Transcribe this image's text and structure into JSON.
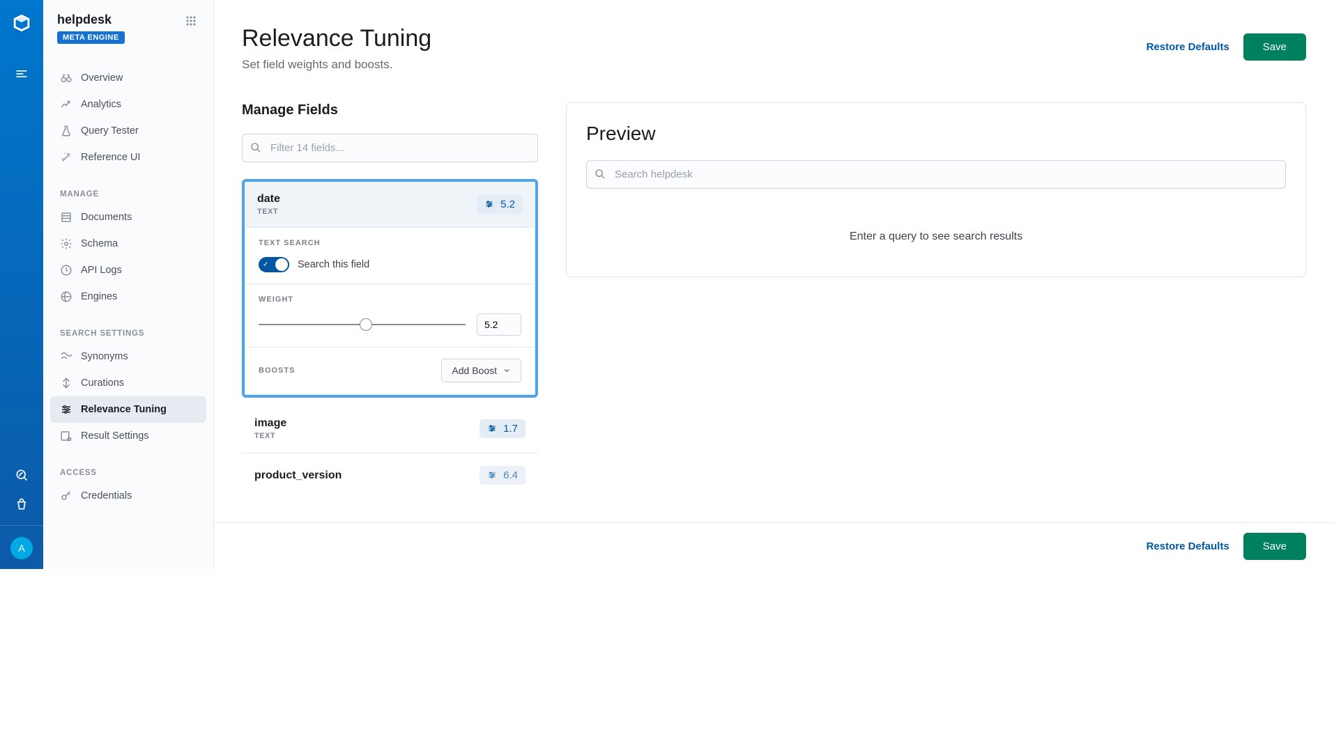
{
  "rail": {
    "avatar_letter": "A"
  },
  "sidebar": {
    "title": "helpdesk",
    "badge": "META ENGINE",
    "items": [
      {
        "label": "Overview"
      },
      {
        "label": "Analytics"
      },
      {
        "label": "Query Tester"
      },
      {
        "label": "Reference UI"
      }
    ],
    "manage_label": "MANAGE",
    "manage_items": [
      {
        "label": "Documents"
      },
      {
        "label": "Schema"
      },
      {
        "label": "API Logs"
      },
      {
        "label": "Engines"
      }
    ],
    "search_settings_label": "SEARCH SETTINGS",
    "search_items": [
      {
        "label": "Synonyms"
      },
      {
        "label": "Curations"
      },
      {
        "label": "Relevance Tuning"
      },
      {
        "label": "Result Settings"
      }
    ],
    "access_label": "ACCESS",
    "access_items": [
      {
        "label": "Credentials"
      }
    ]
  },
  "page": {
    "title": "Relevance Tuning",
    "subtitle": "Set field weights and boosts.",
    "restore": "Restore Defaults",
    "save": "Save"
  },
  "manage": {
    "title": "Manage Fields",
    "filter_placeholder": "Filter 14 fields...",
    "fields": [
      {
        "name": "date",
        "type": "TEXT",
        "weight": "5.2"
      },
      {
        "name": "image",
        "type": "TEXT",
        "weight": "1.7"
      },
      {
        "name": "product_version",
        "type": "",
        "weight": "6.4"
      }
    ],
    "expanded": {
      "text_search_label": "TEXT SEARCH",
      "search_field_label": "Search this field",
      "weight_label": "WEIGHT",
      "weight_value": "5.2",
      "slider_percent": 52,
      "boosts_label": "BOOSTS",
      "add_boost": "Add Boost"
    }
  },
  "preview": {
    "title": "Preview",
    "search_placeholder": "Search helpdesk",
    "empty": "Enter a query to see search results"
  }
}
